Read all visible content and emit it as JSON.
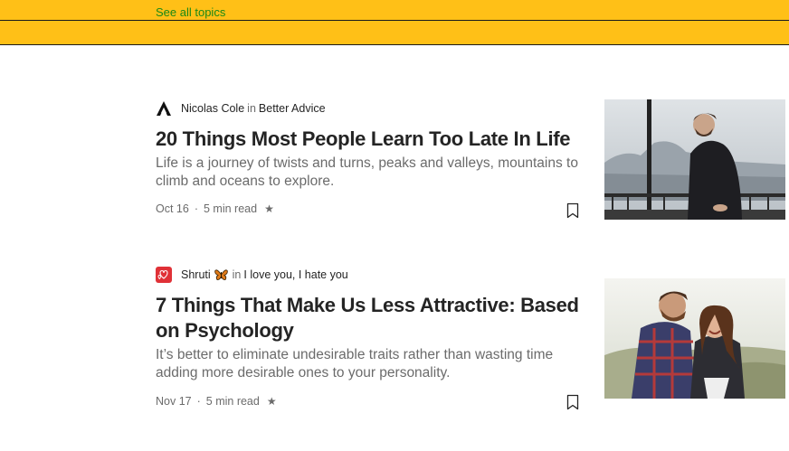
{
  "topbar": {
    "see_all_label": "See all topics"
  },
  "articles": [
    {
      "author": "Nicolas Cole",
      "in_label": "in",
      "publication": "Better Advice",
      "title": "20 Things Most People Learn Too Late In Life",
      "subtitle": "Life is a journey of twists and turns, peaks and valleys, mountains to climb and oceans to explore.",
      "date": "Oct 16",
      "read_time": "5 min read",
      "star": "★",
      "publication_icon": "triangle-a-icon",
      "thumbnail": "man-on-bridge-photo"
    },
    {
      "author": "Shruti",
      "in_label": "in",
      "publication": "I love you, I hate you",
      "title": "7 Things That Make Us Less Attractive: Based on Psychology",
      "subtitle": "It’s better to eliminate undesirable traits rather than wasting time adding more desirable ones to your personality.",
      "date": "Nov 17",
      "read_time": "5 min read",
      "star": "★",
      "publication_icon": "hearts-icon",
      "author_emoji": "butterfly-icon",
      "thumbnail": "couple-photo"
    }
  ],
  "colors": {
    "banner": "#ffc017",
    "link_green": "#1a8917",
    "text": "#242424",
    "muted": "#6b6b6b"
  }
}
